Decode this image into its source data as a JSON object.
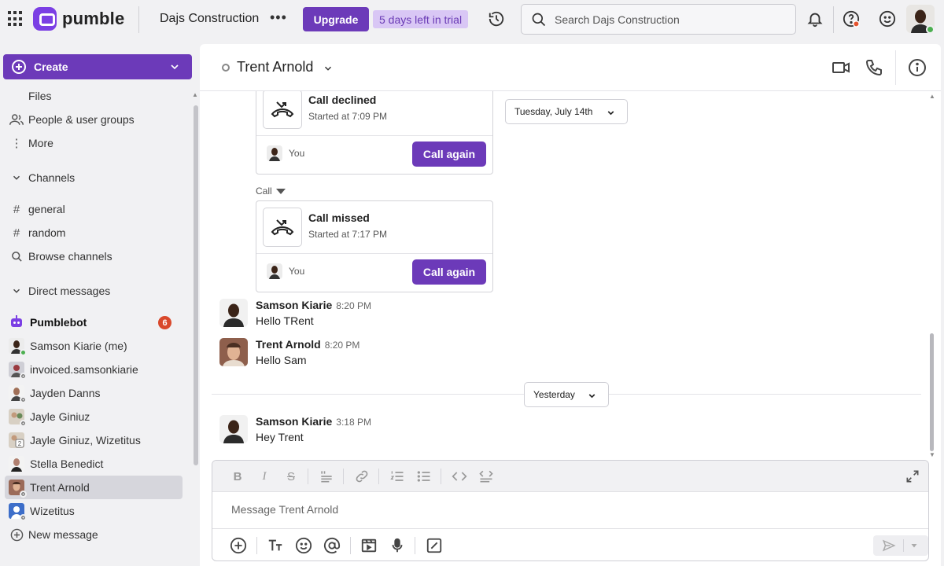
{
  "app": {
    "brand": "pumble",
    "workspace": "Dajs Construction",
    "upgrade_label": "Upgrade",
    "trial_text": "5 days left in trial",
    "search_placeholder": "Search Dajs Construction"
  },
  "sidebar": {
    "create_label": "Create",
    "top_items": [
      {
        "label": "Files",
        "icon": "file-icon"
      },
      {
        "label": "People & user groups",
        "icon": "people-icon"
      },
      {
        "label": "More",
        "icon": "more-vertical-icon"
      }
    ],
    "channels_header": "Channels",
    "channels": [
      {
        "label": "general",
        "icon": "hash-icon"
      },
      {
        "label": "random",
        "icon": "hash-icon"
      },
      {
        "label": "Browse channels",
        "icon": "search-icon"
      }
    ],
    "dm_header": "Direct messages",
    "dms": [
      {
        "label": "Pumblebot",
        "badge": "6",
        "bold": true
      },
      {
        "label": "Samson Kiarie (me)"
      },
      {
        "label": "invoiced.samsonkiarie"
      },
      {
        "label": "Jayden Danns"
      },
      {
        "label": "Jayle Giniuz"
      },
      {
        "label": "Jayle Giniuz, Wizetitus"
      },
      {
        "label": "Stella Benedict"
      },
      {
        "label": "Trent Arnold",
        "active": true
      },
      {
        "label": "Wizetitus"
      }
    ],
    "new_message_label": "New message"
  },
  "conversation": {
    "title": "Trent Arnold",
    "message_placeholder": "Message Trent Arnold",
    "date_pills": {
      "first": "Tuesday, July 14th",
      "second": "Yesterday"
    },
    "calls": [
      {
        "title": "Call declined",
        "started": "Started at 7:09 PM",
        "you": "You",
        "button": "Call again"
      },
      {
        "title": "Call missed",
        "started": "Started at 7:17 PM",
        "you": "You",
        "button": "Call again"
      }
    ],
    "call_label": "Call",
    "messages": [
      {
        "author": "Samson Kiarie",
        "time": "8:20 PM",
        "text": "Hello TRent"
      },
      {
        "author": "Trent Arnold",
        "time": "8:20 PM",
        "text": "Hello Sam"
      },
      {
        "author": "Samson Kiarie",
        "time": "3:18 PM",
        "text": "Hey Trent"
      }
    ]
  },
  "colors": {
    "accent": "#6c3ab9",
    "badge": "#d9482b",
    "trial_bg": "#d9c7f5",
    "online": "#4caf50"
  }
}
